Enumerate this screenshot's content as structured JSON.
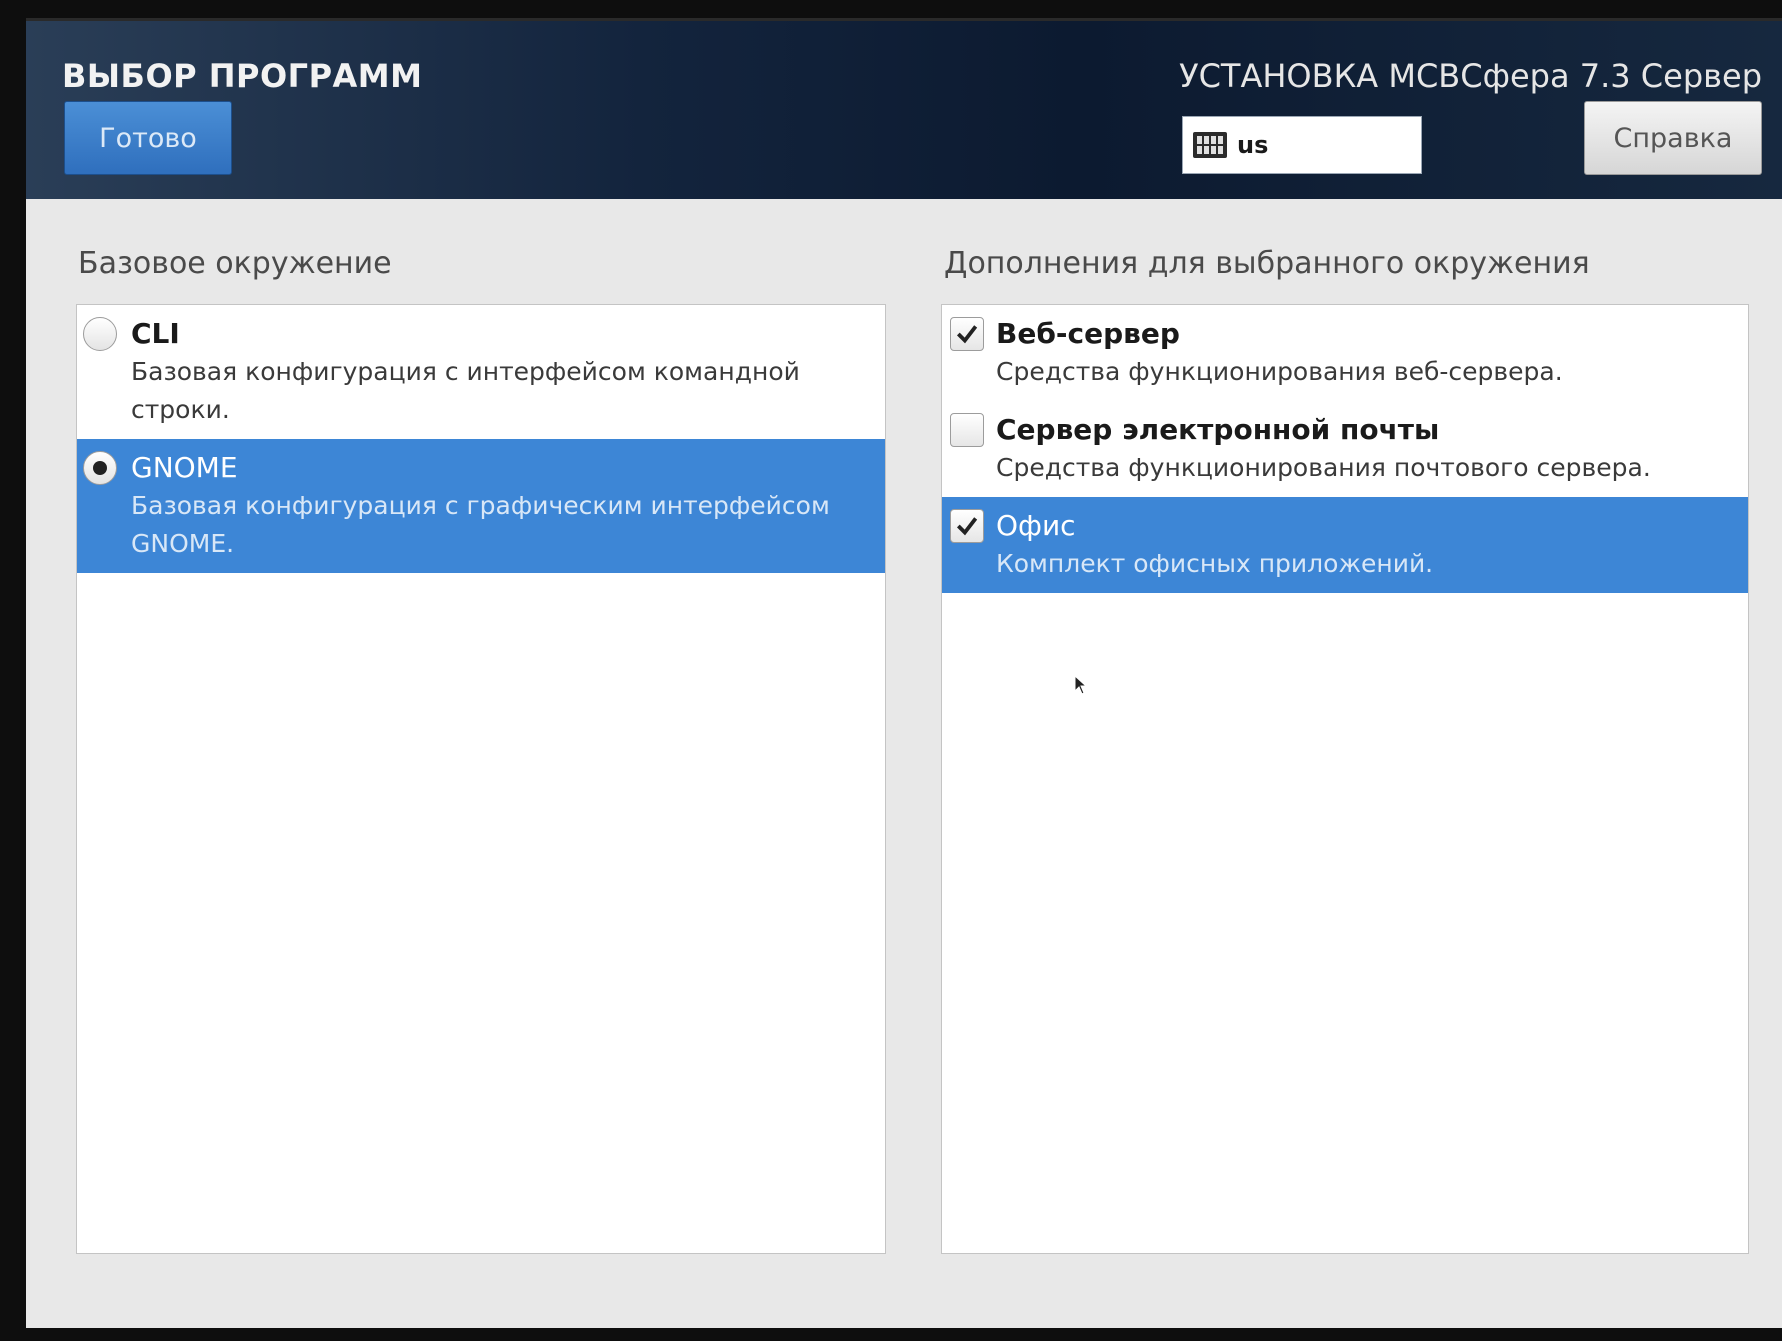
{
  "header": {
    "page_title": "ВЫБОР ПРОГРАММ",
    "done_label": "Готово",
    "product_title": "УСТАНОВКА МСВСфера 7.3 Сервер",
    "keyboard_layout": "us",
    "help_label": "Справка"
  },
  "base_environment": {
    "heading": "Базовое окружение",
    "items": [
      {
        "title": "CLI",
        "desc": "Базовая конфигурация с интерфейсом командной строки.",
        "selected": false
      },
      {
        "title": "GNOME",
        "desc": "Базовая конфигурация с графическим интерфейсом GNOME.",
        "selected": true
      }
    ]
  },
  "addons": {
    "heading": "Дополнения для выбранного окружения",
    "items": [
      {
        "title": "Веб-сервер",
        "desc": "Средства функционирования веб-сервера.",
        "checked": true,
        "selected": false
      },
      {
        "title": "Сервер электронной почты",
        "desc": "Средства функционирования почтового сервера.",
        "checked": false,
        "selected": false
      },
      {
        "title": "Офис",
        "desc": "Комплект офисных приложений.",
        "checked": true,
        "selected": true
      }
    ]
  },
  "colors": {
    "header_bg": "#0c1a30",
    "accent_blue": "#3d86d6",
    "window_bg": "#e8e8e8"
  }
}
